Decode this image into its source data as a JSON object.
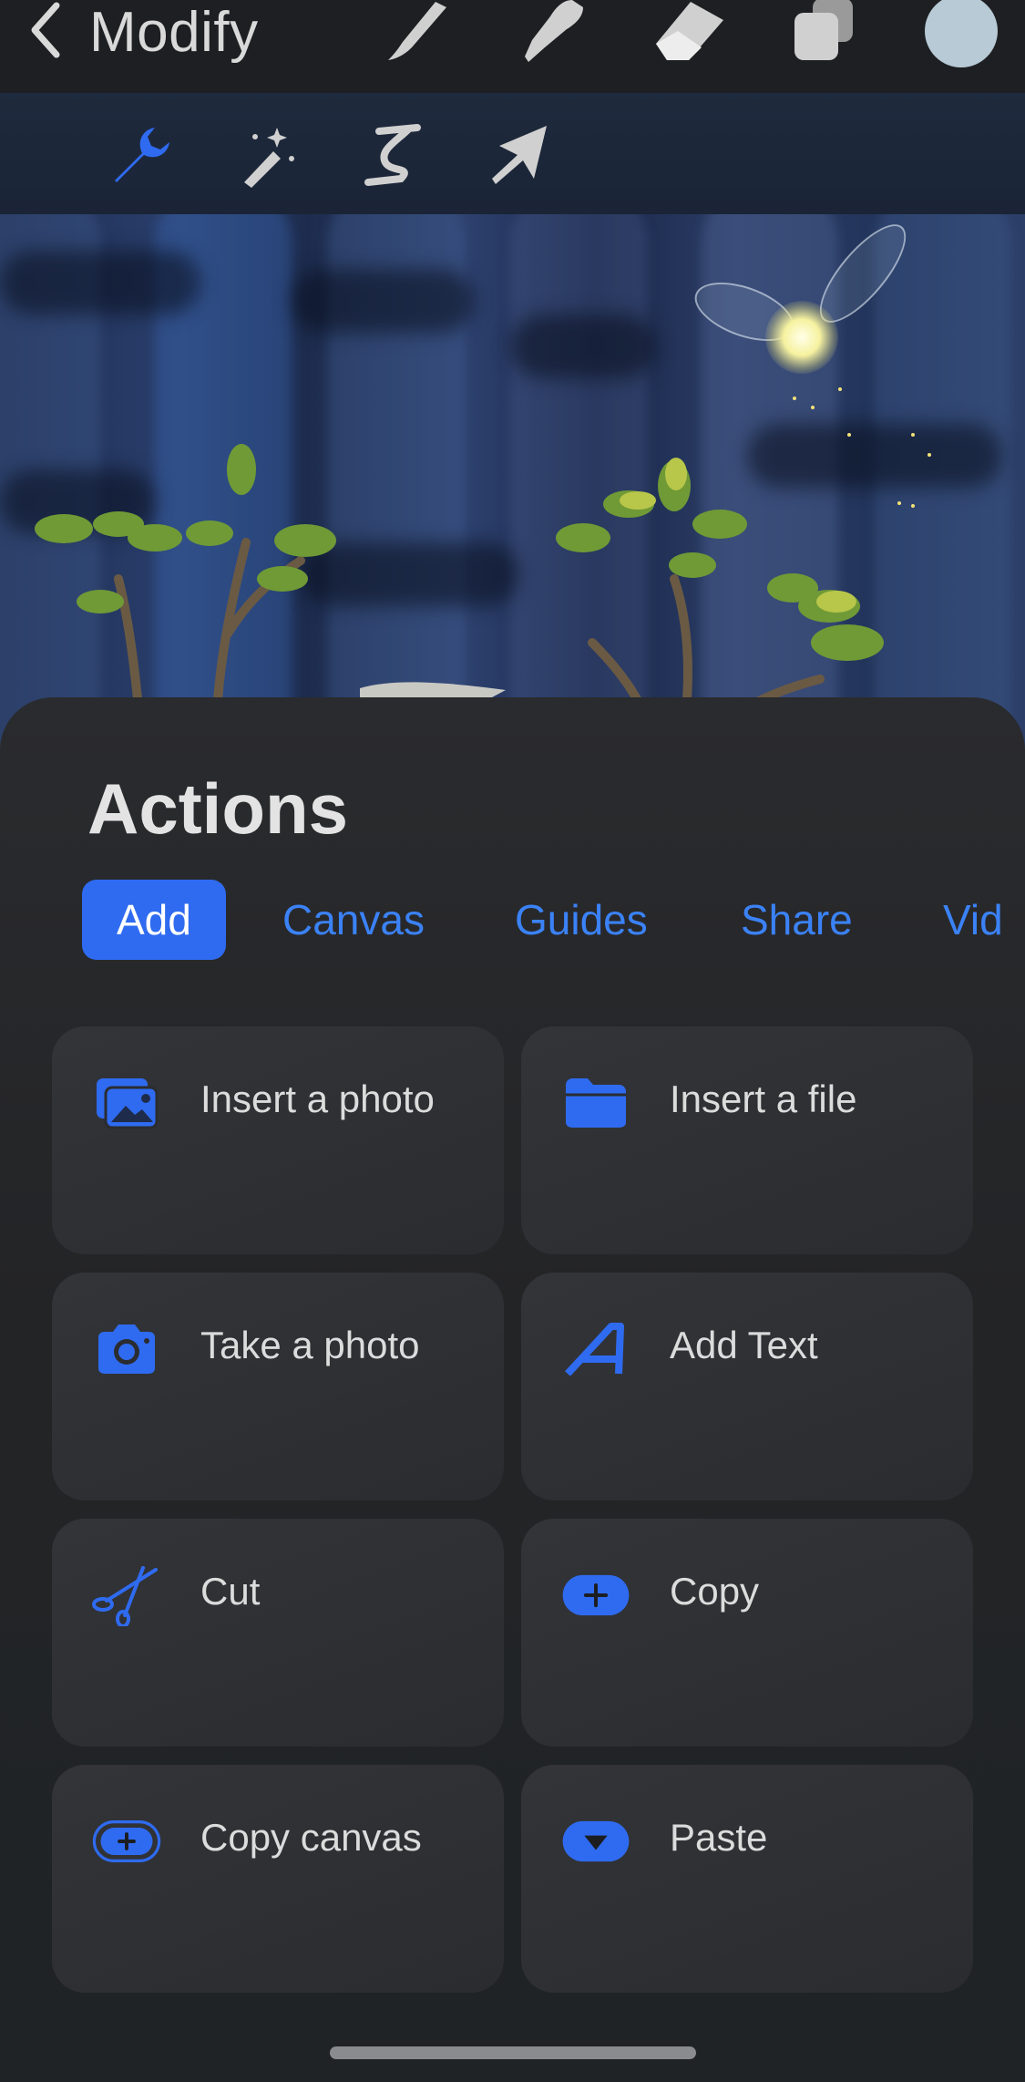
{
  "header": {
    "back_label": "Modify",
    "tools": [
      {
        "name": "brush",
        "icon": "brush-icon"
      },
      {
        "name": "smudge",
        "icon": "smudge-icon"
      },
      {
        "name": "eraser",
        "icon": "eraser-icon"
      },
      {
        "name": "layers",
        "icon": "layers-icon"
      },
      {
        "name": "color",
        "icon": "color-swatch",
        "color": "#b7cad6"
      }
    ]
  },
  "toolbar": {
    "tools": [
      {
        "name": "actions",
        "icon": "wrench-icon",
        "active": true
      },
      {
        "name": "adjustments",
        "icon": "magic-wand-icon"
      },
      {
        "name": "selection",
        "icon": "selection-icon"
      },
      {
        "name": "transform",
        "icon": "arrow-cursor-icon"
      }
    ]
  },
  "actions": {
    "title": "Actions",
    "tabs": [
      {
        "label": "Add",
        "active": true
      },
      {
        "label": "Canvas"
      },
      {
        "label": "Guides"
      },
      {
        "label": "Share"
      },
      {
        "label": "Vid"
      }
    ],
    "items": [
      {
        "label": "Insert a photo",
        "icon": "photo-icon"
      },
      {
        "label": "Insert a file",
        "icon": "folder-icon"
      },
      {
        "label": "Take a photo",
        "icon": "camera-icon"
      },
      {
        "label": "Add Text",
        "icon": "text-icon"
      },
      {
        "label": "Cut",
        "icon": "scissors-icon"
      },
      {
        "label": "Copy",
        "icon": "copy-plus-icon"
      },
      {
        "label": "Copy canvas",
        "icon": "copy-canvas-icon"
      },
      {
        "label": "Paste",
        "icon": "paste-icon"
      }
    ]
  },
  "colors": {
    "accent": "#2f6bf0",
    "link": "#3b82f6",
    "sheet_bg": "#2a2b2e",
    "card_bg": "#323438"
  }
}
